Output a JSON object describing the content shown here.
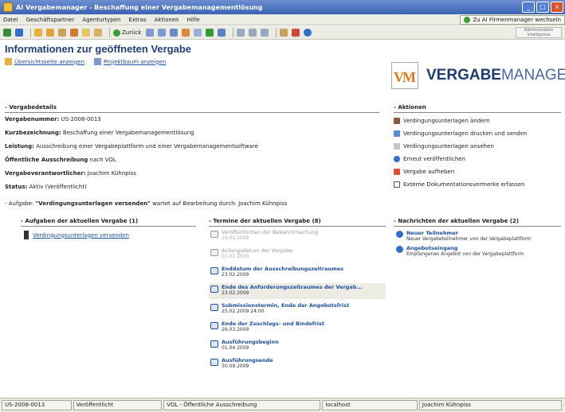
{
  "window": {
    "title": "AI Vergabemanager - Beschaffung einer Vergabemanagementlösung",
    "controls": [
      "_",
      "□",
      "x"
    ]
  },
  "menu": {
    "items": [
      "Datei",
      "Geschäftspartner",
      "Agenturtypen",
      "Extras",
      "Aktionen",
      "Hilfe"
    ],
    "right_link": "Zu AI Firmenmanager wechseln"
  },
  "toolbar": {
    "back_label": "Zurück",
    "brand_text": "Administration Intelligence"
  },
  "header": {
    "title": "Informationen zur geöffneten Vergabe",
    "link_overview": "Übersichtsseite anzeigen",
    "link_project": "Projektbaum anzeigen"
  },
  "logo": {
    "mark": "VM",
    "bold": "VERGABE",
    "light": "MANAGER"
  },
  "details": {
    "heading": "Vergabedetails",
    "rows": [
      {
        "key": "Vergabenummer:",
        "value": "US-2008-0013"
      },
      {
        "key": "Kurzbezeichnung:",
        "value": "Beschaffung einer Vergabemanagementlösung"
      },
      {
        "key": "Leistung:",
        "value": "Ausschreibung einer Vergabeplattform und einer Vergabemanagementsoftware"
      },
      {
        "key": "Öffentliche Ausschreibung",
        "value": "nach VOL"
      },
      {
        "key": "Vergabeverantwortlicher:",
        "value": "Joachim Kühnpiss"
      },
      {
        "key": "Status:",
        "value": "Aktiv (Veröffentlicht)"
      }
    ],
    "task_prefix": "- Aufgabe:",
    "task_name": "\"Verdingungsunterlagen versenden\"",
    "task_suffix": "wartet auf Bearbeitung durch: Joachim Kühnpiss"
  },
  "actions": {
    "heading": "Aktionen",
    "items": [
      "Verdingungsunterlagen ändern",
      "Verdingungsunterlagen drucken und senden",
      "Verdingungsunterlagen ansehen",
      "Erneut veröffentlichen",
      "Vergabe aufheben",
      "Externe Dokumentationsvermerke erfassen"
    ]
  },
  "tasks": {
    "heading": "Aufgaben der aktuellen Vergabe (1)",
    "items": [
      "Verdingungsunterlagen versenden"
    ]
  },
  "appointments": {
    "heading": "Termine der aktuellen Vergabe (8)",
    "items": [
      {
        "title": "Veröffentlichen der Bekanntmachung",
        "date": "19.01.2009",
        "past": true,
        "highlight": false
      },
      {
        "title": "Anfangsdatum der Vergabe",
        "date": "01.02.2009",
        "past": true,
        "highlight": false
      },
      {
        "title": "Enddatum der Ausschreibungszeitraumes",
        "date": "23.02.2009",
        "past": false,
        "highlight": false
      },
      {
        "title": "Ende des Anforderungszeitraumes der Vergab...",
        "date": "23.02.2009",
        "past": false,
        "highlight": true
      },
      {
        "title": "Submissionstermin, Ende der Angebotsfrist",
        "date": "25.02.2009 24:00",
        "past": false,
        "highlight": false
      },
      {
        "title": "Ende der Zuschlags- und Bindefrist",
        "date": "26.03.2009",
        "past": false,
        "highlight": false
      },
      {
        "title": "Ausführungsbeginn",
        "date": "01.04.2009",
        "past": false,
        "highlight": false
      },
      {
        "title": "Ausführungsende",
        "date": "30.09.2009",
        "past": false,
        "highlight": false
      }
    ]
  },
  "news": {
    "heading": "Nachrichten der aktuellen Vergabe (2)",
    "items": [
      {
        "title": "Neuer Teilnehmer",
        "desc": "Neuer Vergabeteilnehmer von der Vergabeplattform"
      },
      {
        "title": "Angebotseingang",
        "desc": "Empfangenes Angebot von der Vergabeplattform"
      }
    ]
  },
  "statusbar": [
    "US-2008-0013",
    "Veröffentlicht",
    "VOL - Öffentliche Ausschreibung",
    "localhost",
    "Joachim Kühnpiss"
  ],
  "colors": {
    "titlebar": "#3b62b5",
    "link": "#1f4fa0",
    "logo_orange": "#e07a1a",
    "logo_blue": "#1d3a73"
  }
}
